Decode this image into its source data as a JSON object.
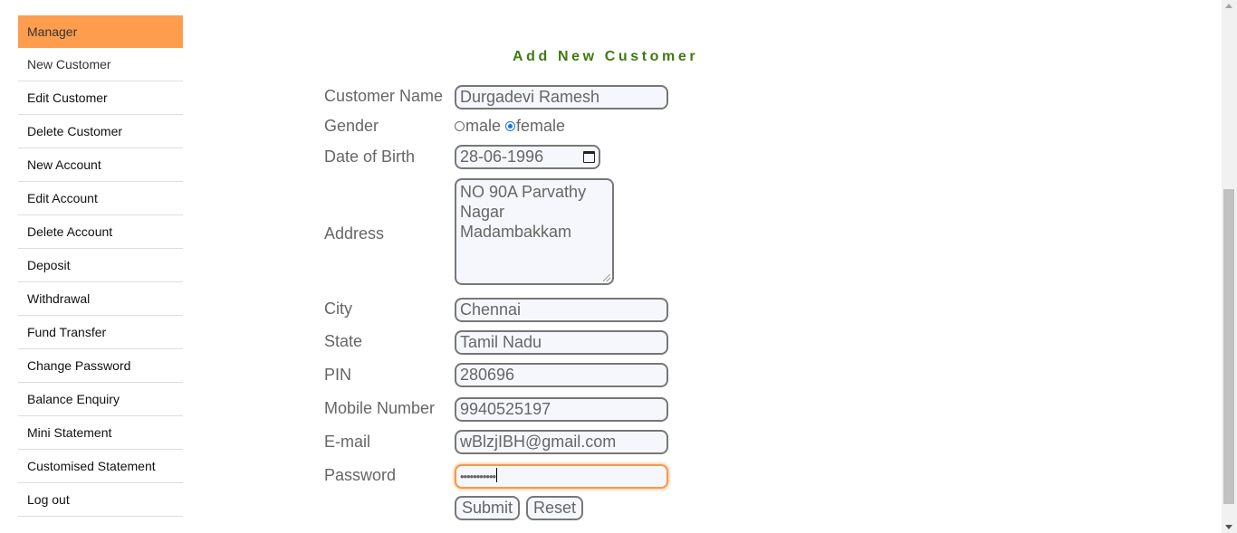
{
  "sidebar": {
    "header": "Manager",
    "items": [
      "New Customer",
      "Edit Customer",
      "Delete Customer",
      "New Account",
      "Edit Account",
      "Delete Account",
      "Deposit",
      "Withdrawal",
      "Fund Transfer",
      "Change Password",
      "Balance Enquiry",
      "Mini Statement",
      "Customised Statement",
      "Log out"
    ]
  },
  "form": {
    "title": "Add New Customer",
    "labels": {
      "name": "Customer Name",
      "gender": "Gender",
      "dob": "Date of Birth",
      "address": "Address",
      "city": "City",
      "state": "State",
      "pin": "PIN",
      "mobile": "Mobile Number",
      "email": "E-mail",
      "password": "Password"
    },
    "values": {
      "name": "Durgadevi Ramesh",
      "gender_options": [
        "male",
        "female"
      ],
      "gender_selected": "female",
      "dob": "28-06-1996",
      "address_lines": [
        "NO 90A Parvathy",
        "Nagar",
        "Madambakkam"
      ],
      "city": "Chennai",
      "state": "Tamil Nadu",
      "pin": "280696",
      "mobile": "9940525197",
      "email": "wBlzjIBH@gmail.com",
      "password_masked": "•••••••••••"
    },
    "buttons": {
      "submit": "Submit",
      "reset": "Reset"
    }
  },
  "colors": {
    "menu_header_bg": "#FF9D4F",
    "title_green": "#3E7A11",
    "field_border": "#777777",
    "focus_orange": "#F29A4B",
    "radio_blue": "#1A73E8"
  }
}
